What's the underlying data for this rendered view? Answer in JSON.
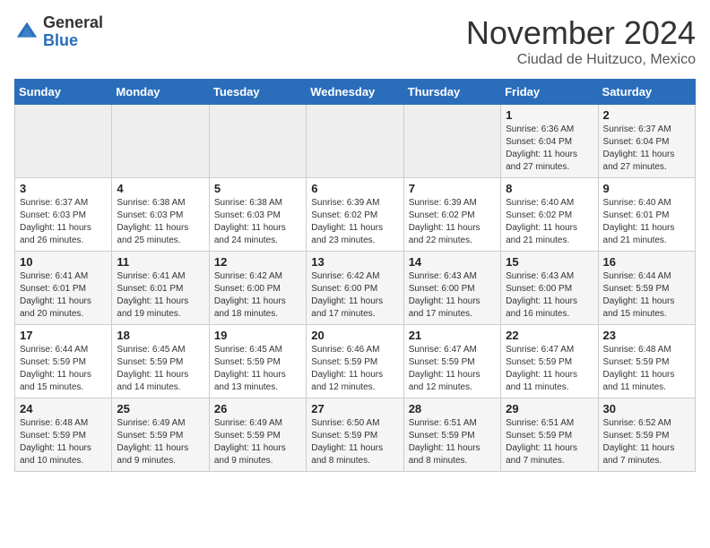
{
  "logo": {
    "general": "General",
    "blue": "Blue"
  },
  "title": "November 2024",
  "subtitle": "Ciudad de Huitzuco, Mexico",
  "days_of_week": [
    "Sunday",
    "Monday",
    "Tuesday",
    "Wednesday",
    "Thursday",
    "Friday",
    "Saturday"
  ],
  "weeks": [
    [
      {
        "day": "",
        "info": ""
      },
      {
        "day": "",
        "info": ""
      },
      {
        "day": "",
        "info": ""
      },
      {
        "day": "",
        "info": ""
      },
      {
        "day": "",
        "info": ""
      },
      {
        "day": "1",
        "info": "Sunrise: 6:36 AM\nSunset: 6:04 PM\nDaylight: 11 hours and 27 minutes."
      },
      {
        "day": "2",
        "info": "Sunrise: 6:37 AM\nSunset: 6:04 PM\nDaylight: 11 hours and 27 minutes."
      }
    ],
    [
      {
        "day": "3",
        "info": "Sunrise: 6:37 AM\nSunset: 6:03 PM\nDaylight: 11 hours and 26 minutes."
      },
      {
        "day": "4",
        "info": "Sunrise: 6:38 AM\nSunset: 6:03 PM\nDaylight: 11 hours and 25 minutes."
      },
      {
        "day": "5",
        "info": "Sunrise: 6:38 AM\nSunset: 6:03 PM\nDaylight: 11 hours and 24 minutes."
      },
      {
        "day": "6",
        "info": "Sunrise: 6:39 AM\nSunset: 6:02 PM\nDaylight: 11 hours and 23 minutes."
      },
      {
        "day": "7",
        "info": "Sunrise: 6:39 AM\nSunset: 6:02 PM\nDaylight: 11 hours and 22 minutes."
      },
      {
        "day": "8",
        "info": "Sunrise: 6:40 AM\nSunset: 6:02 PM\nDaylight: 11 hours and 21 minutes."
      },
      {
        "day": "9",
        "info": "Sunrise: 6:40 AM\nSunset: 6:01 PM\nDaylight: 11 hours and 21 minutes."
      }
    ],
    [
      {
        "day": "10",
        "info": "Sunrise: 6:41 AM\nSunset: 6:01 PM\nDaylight: 11 hours and 20 minutes."
      },
      {
        "day": "11",
        "info": "Sunrise: 6:41 AM\nSunset: 6:01 PM\nDaylight: 11 hours and 19 minutes."
      },
      {
        "day": "12",
        "info": "Sunrise: 6:42 AM\nSunset: 6:00 PM\nDaylight: 11 hours and 18 minutes."
      },
      {
        "day": "13",
        "info": "Sunrise: 6:42 AM\nSunset: 6:00 PM\nDaylight: 11 hours and 17 minutes."
      },
      {
        "day": "14",
        "info": "Sunrise: 6:43 AM\nSunset: 6:00 PM\nDaylight: 11 hours and 17 minutes."
      },
      {
        "day": "15",
        "info": "Sunrise: 6:43 AM\nSunset: 6:00 PM\nDaylight: 11 hours and 16 minutes."
      },
      {
        "day": "16",
        "info": "Sunrise: 6:44 AM\nSunset: 5:59 PM\nDaylight: 11 hours and 15 minutes."
      }
    ],
    [
      {
        "day": "17",
        "info": "Sunrise: 6:44 AM\nSunset: 5:59 PM\nDaylight: 11 hours and 15 minutes."
      },
      {
        "day": "18",
        "info": "Sunrise: 6:45 AM\nSunset: 5:59 PM\nDaylight: 11 hours and 14 minutes."
      },
      {
        "day": "19",
        "info": "Sunrise: 6:45 AM\nSunset: 5:59 PM\nDaylight: 11 hours and 13 minutes."
      },
      {
        "day": "20",
        "info": "Sunrise: 6:46 AM\nSunset: 5:59 PM\nDaylight: 11 hours and 12 minutes."
      },
      {
        "day": "21",
        "info": "Sunrise: 6:47 AM\nSunset: 5:59 PM\nDaylight: 11 hours and 12 minutes."
      },
      {
        "day": "22",
        "info": "Sunrise: 6:47 AM\nSunset: 5:59 PM\nDaylight: 11 hours and 11 minutes."
      },
      {
        "day": "23",
        "info": "Sunrise: 6:48 AM\nSunset: 5:59 PM\nDaylight: 11 hours and 11 minutes."
      }
    ],
    [
      {
        "day": "24",
        "info": "Sunrise: 6:48 AM\nSunset: 5:59 PM\nDaylight: 11 hours and 10 minutes."
      },
      {
        "day": "25",
        "info": "Sunrise: 6:49 AM\nSunset: 5:59 PM\nDaylight: 11 hours and 9 minutes."
      },
      {
        "day": "26",
        "info": "Sunrise: 6:49 AM\nSunset: 5:59 PM\nDaylight: 11 hours and 9 minutes."
      },
      {
        "day": "27",
        "info": "Sunrise: 6:50 AM\nSunset: 5:59 PM\nDaylight: 11 hours and 8 minutes."
      },
      {
        "day": "28",
        "info": "Sunrise: 6:51 AM\nSunset: 5:59 PM\nDaylight: 11 hours and 8 minutes."
      },
      {
        "day": "29",
        "info": "Sunrise: 6:51 AM\nSunset: 5:59 PM\nDaylight: 11 hours and 7 minutes."
      },
      {
        "day": "30",
        "info": "Sunrise: 6:52 AM\nSunset: 5:59 PM\nDaylight: 11 hours and 7 minutes."
      }
    ]
  ]
}
